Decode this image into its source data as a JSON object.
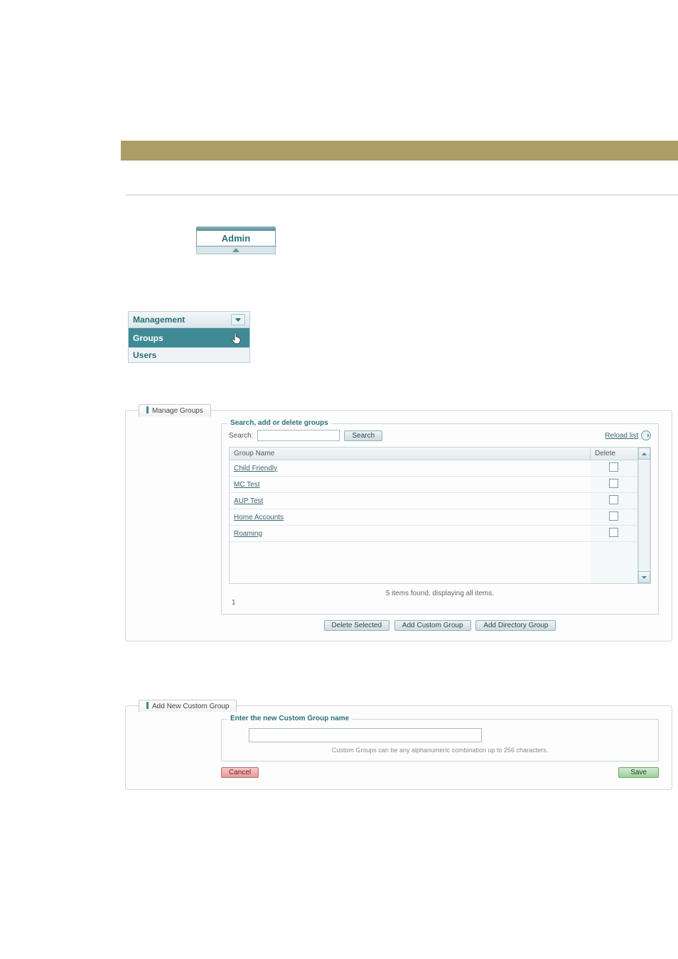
{
  "admin_tab": {
    "label": "Admin"
  },
  "mgmt_menu": {
    "header": "Management",
    "items": [
      {
        "label": "Groups",
        "active": true
      },
      {
        "label": "Users",
        "active": false
      }
    ]
  },
  "manage_groups": {
    "tab_label": "Manage Groups",
    "fieldset_legend": "Search, add or delete groups",
    "search_label": "Search:",
    "search_value": "",
    "search_button": "Search",
    "reload_label": "Reload list",
    "columns": {
      "name": "Group Name",
      "delete": "Delete"
    },
    "rows": [
      {
        "name": "Child Friendly"
      },
      {
        "name": "MC Test"
      },
      {
        "name": "AUP Test"
      },
      {
        "name": "Home Accounts"
      },
      {
        "name": "Roaming"
      }
    ],
    "status": "5 items found, displaying all items.",
    "page_indicator": "1",
    "buttons": {
      "delete_selected": "Delete Selected",
      "add_custom": "Add Custom Group",
      "add_directory": "Add Directory Group"
    }
  },
  "add_custom": {
    "tab_label": "Add New Custom Group",
    "fieldset_legend": "Enter the new Custom Group name",
    "input_value": "",
    "hint": "Custom Groups can be any alphanumeric combination up to 256 characters.",
    "cancel": "Cancel",
    "save": "Save"
  }
}
